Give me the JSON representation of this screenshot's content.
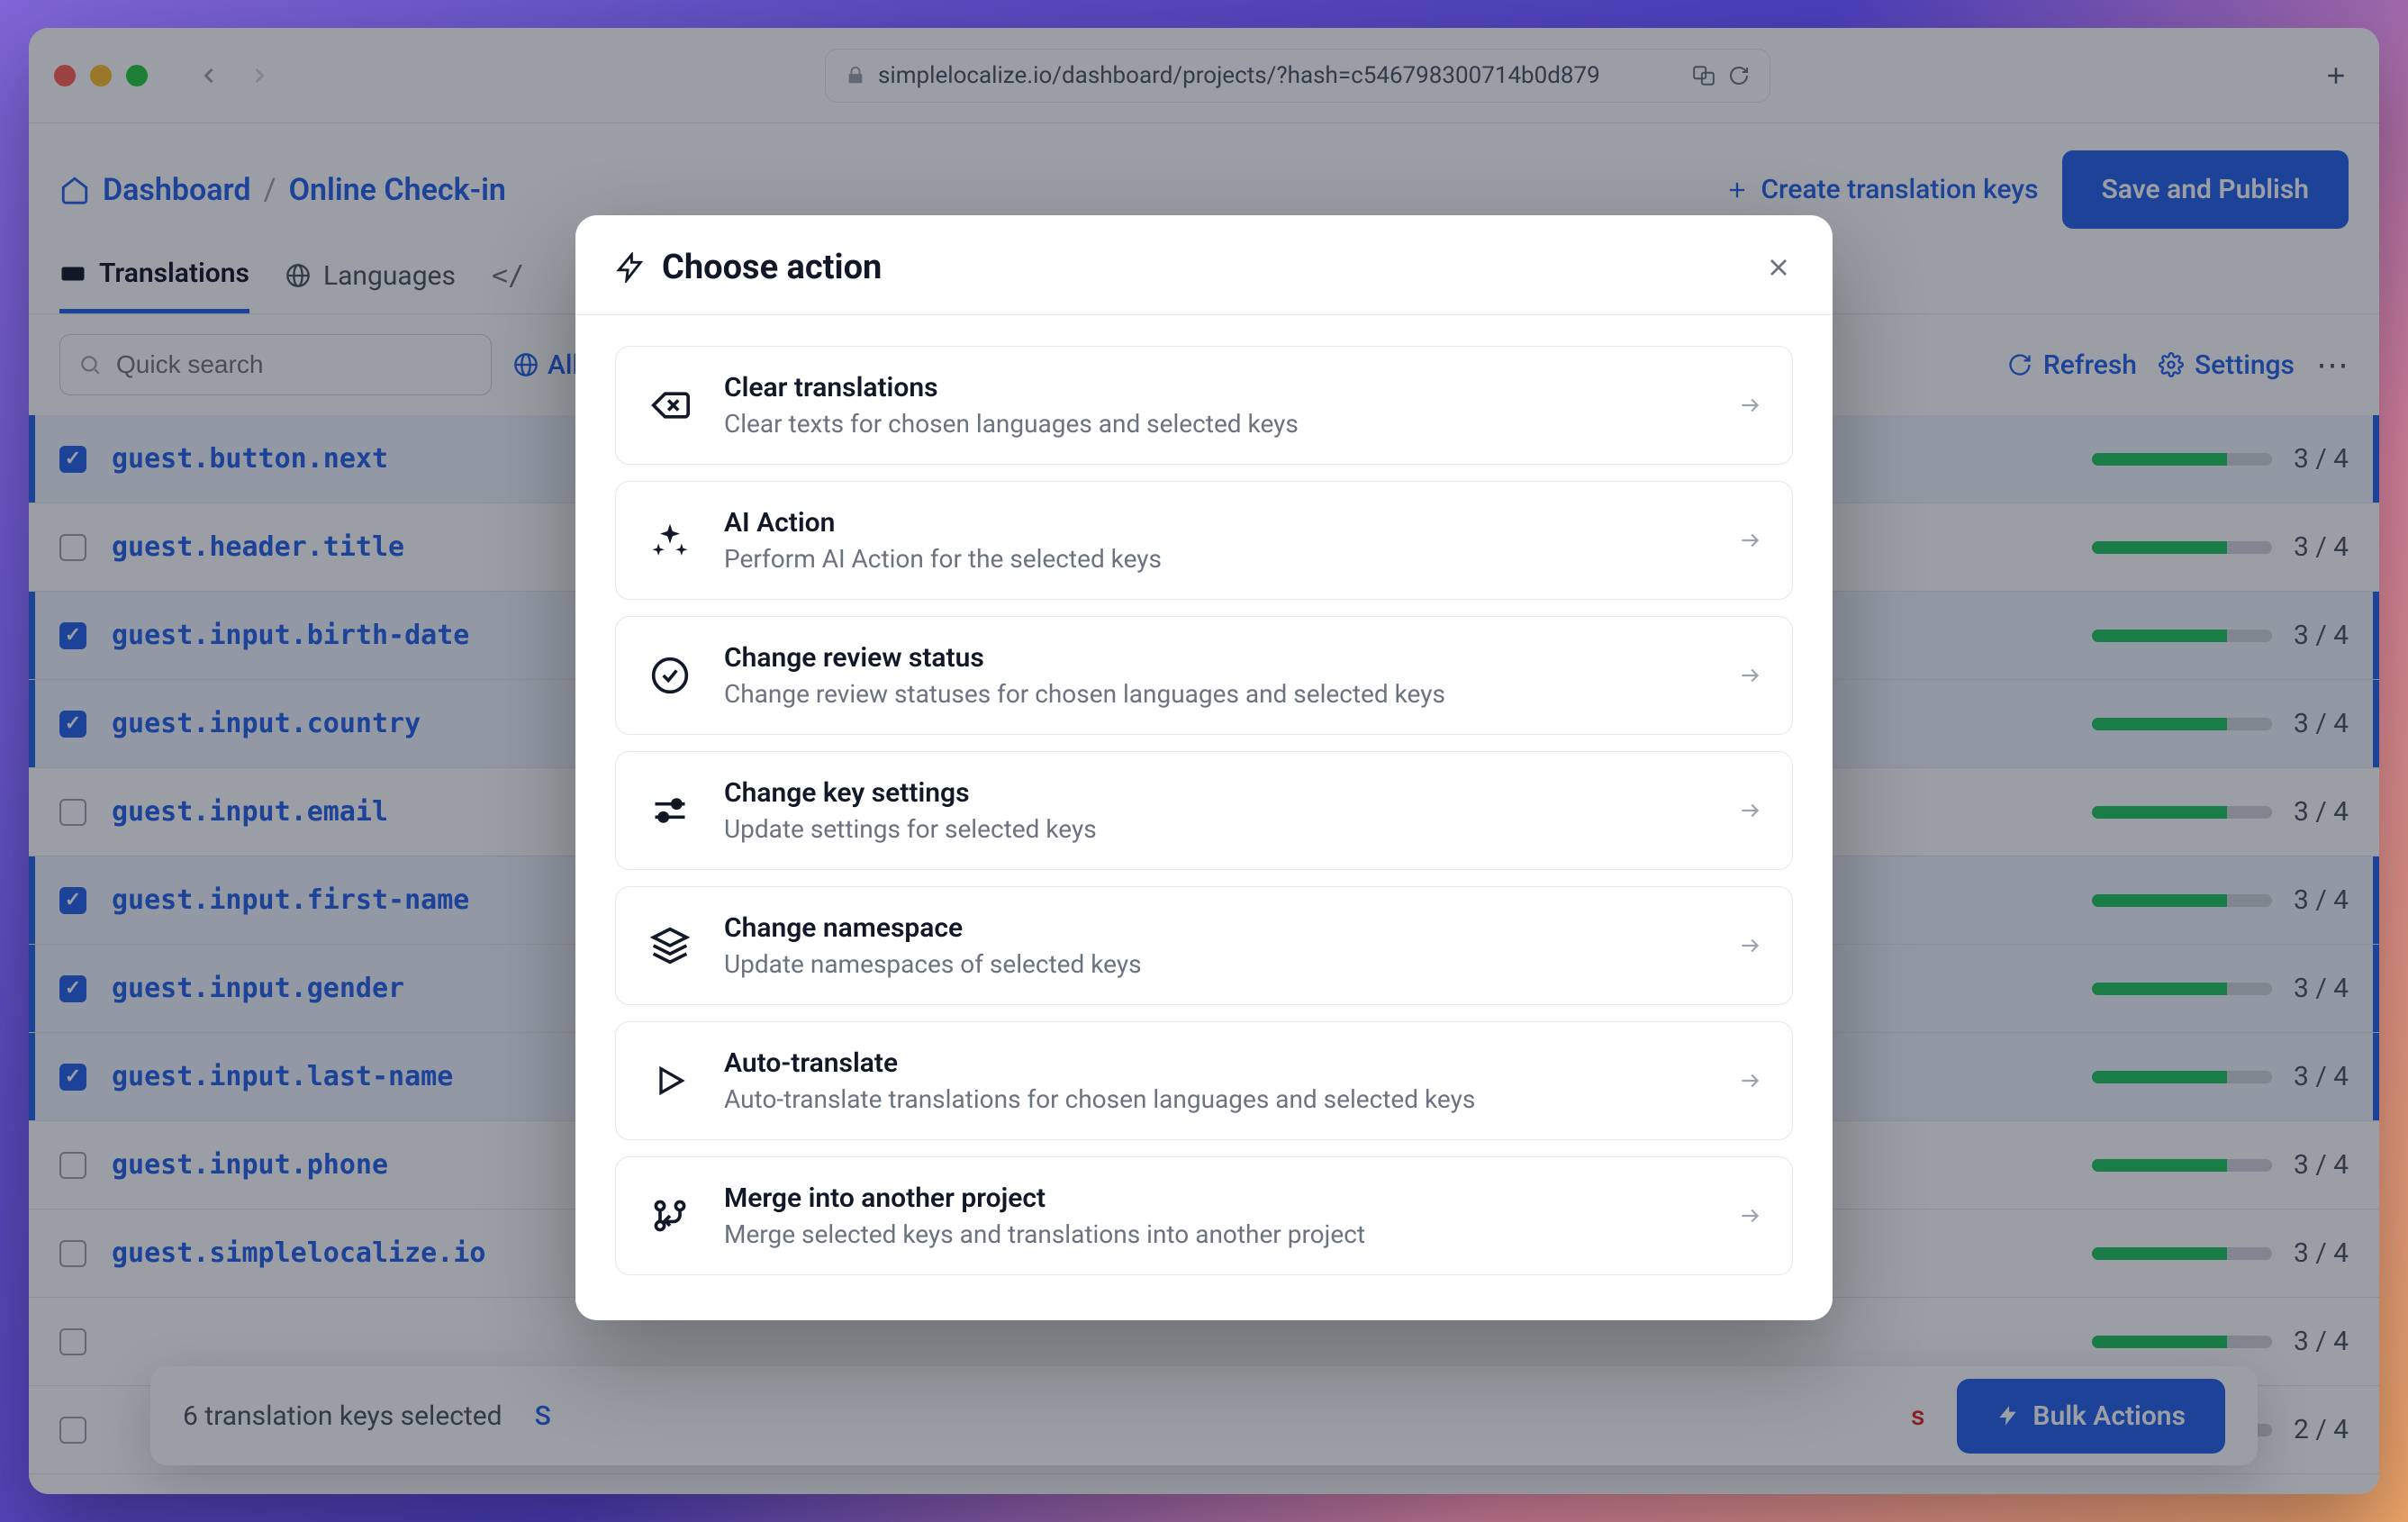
{
  "browser": {
    "url": "simplelocalize.io/dashboard/projects/?hash=c546798300714b0d879"
  },
  "breadcrumb": {
    "home": "Dashboard",
    "separator": "/",
    "current": "Online Check-in"
  },
  "header": {
    "create_keys": "Create translation keys",
    "save_publish": "Save and Publish"
  },
  "tabs": [
    {
      "label": "Translations",
      "active": true
    },
    {
      "label": "Languages",
      "active": false
    }
  ],
  "toolbar": {
    "search_placeholder": "Quick search",
    "all": "All",
    "refresh": "Refresh",
    "settings": "Settings"
  },
  "rows": [
    {
      "checked": true,
      "key": "guest.button.next",
      "done": 3,
      "total": 4
    },
    {
      "checked": false,
      "key": "guest.header.title",
      "done": 3,
      "total": 4
    },
    {
      "checked": true,
      "key": "guest.input.birth-date",
      "done": 3,
      "total": 4
    },
    {
      "checked": true,
      "key": "guest.input.country",
      "done": 3,
      "total": 4
    },
    {
      "checked": false,
      "key": "guest.input.email",
      "done": 3,
      "total": 4
    },
    {
      "checked": true,
      "key": "guest.input.first-name",
      "done": 3,
      "total": 4
    },
    {
      "checked": true,
      "key": "guest.input.gender",
      "done": 3,
      "total": 4
    },
    {
      "checked": true,
      "key": "guest.input.last-name",
      "done": 3,
      "total": 4
    },
    {
      "checked": false,
      "key": "guest.input.phone",
      "done": 3,
      "total": 4
    },
    {
      "checked": false,
      "key": "guest.simplelocalize.io",
      "done": 3,
      "total": 4
    },
    {
      "checked": false,
      "key": "",
      "done": 3,
      "total": 4
    },
    {
      "checked": false,
      "key": "",
      "done": 2,
      "total": 4
    }
  ],
  "selection_bar": {
    "text": "6 translation keys selected",
    "select_all_partial": "S",
    "delete_partial": "s",
    "bulk": "Bulk Actions"
  },
  "modal": {
    "title": "Choose action",
    "actions": [
      {
        "icon": "backspace",
        "title": "Clear translations",
        "sub": "Clear texts for chosen languages and selected keys"
      },
      {
        "icon": "sparkle",
        "title": "AI Action",
        "sub": "Perform AI Action for the selected keys"
      },
      {
        "icon": "check",
        "title": "Change review status",
        "sub": "Change review statuses for chosen languages and selected keys"
      },
      {
        "icon": "sliders",
        "title": "Change key settings",
        "sub": "Update settings for selected keys"
      },
      {
        "icon": "layers",
        "title": "Change namespace",
        "sub": "Update namespaces of selected keys"
      },
      {
        "icon": "play",
        "title": "Auto-translate",
        "sub": "Auto-translate translations for chosen languages and selected keys"
      },
      {
        "icon": "merge",
        "title": "Merge into another project",
        "sub": "Merge selected keys and translations into another project"
      }
    ]
  }
}
